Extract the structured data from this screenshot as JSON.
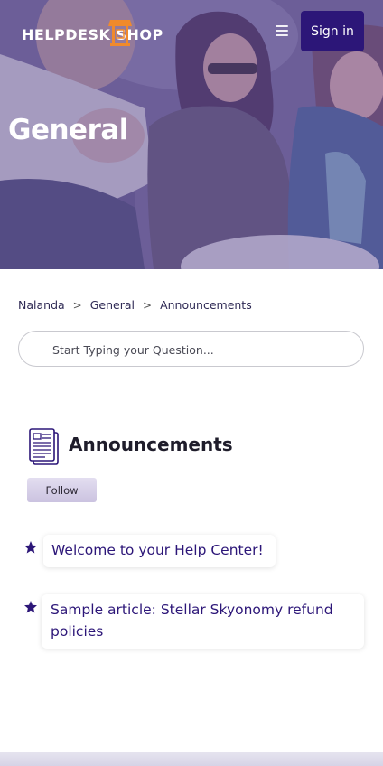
{
  "header": {
    "logo_text": "HELPDESK SHOP",
    "signin_label": "Sign in"
  },
  "hero": {
    "title": "General"
  },
  "breadcrumb": {
    "items": [
      "Nalanda",
      "General",
      "Announcements"
    ],
    "separator": ">"
  },
  "search": {
    "placeholder": "Start Typing your Question..."
  },
  "section": {
    "title": "Announcements",
    "follow_label": "Follow"
  },
  "articles": [
    {
      "title": "Welcome to your Help Center!"
    },
    {
      "title": "Sample article: Stellar Skyonomy refund policies"
    }
  ],
  "colors": {
    "brand": "#2c1678",
    "logo_accent": "#f08a2b",
    "hero_tint": "#6a5a9c"
  },
  "icons": [
    "menu-icon",
    "logo-storefront-icon",
    "document-icon",
    "star-icon"
  ]
}
